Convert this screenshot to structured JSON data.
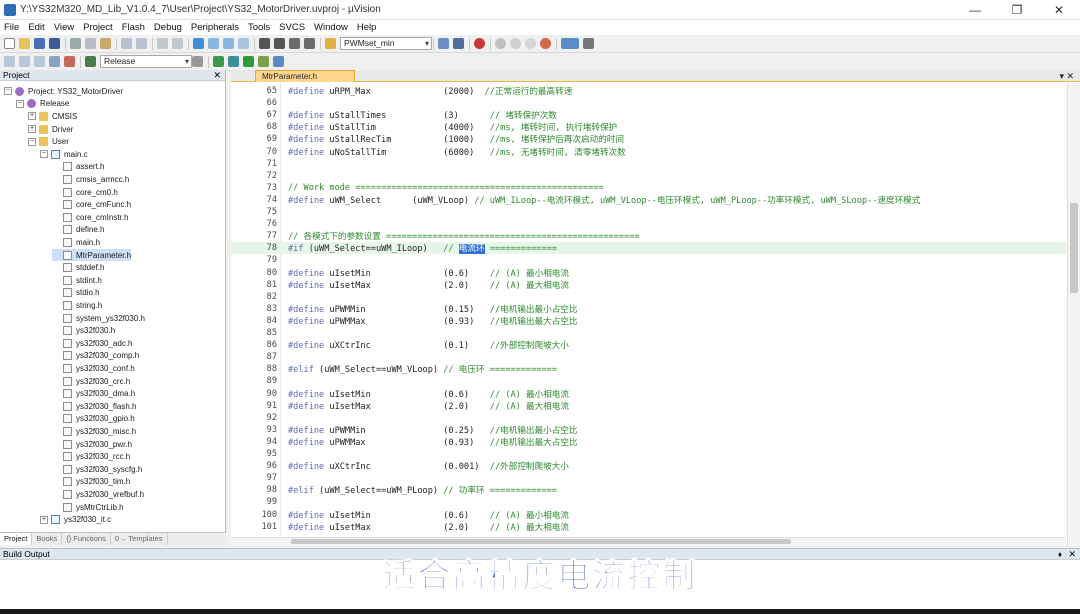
{
  "window": {
    "title": "Y:\\YS32M320_MD_Lib_V1.0.4_7\\User\\Project\\YS32_MotorDriver.uvproj - µVision",
    "controls": [
      "—",
      "❐",
      "✕"
    ]
  },
  "menu": [
    "File",
    "Edit",
    "View",
    "Project",
    "Flash",
    "Debug",
    "Peripherals",
    "Tools",
    "SVCS",
    "Window",
    "Help"
  ],
  "toolbar": {
    "find_combo": "PWMset_min",
    "target_combo": "Release"
  },
  "project_panel": {
    "title": "Project",
    "close": "✕",
    "tree": [
      {
        "label": "Project: YS32_MotorDriver",
        "depth": 0,
        "type": "root",
        "exp": "−"
      },
      {
        "label": "Release",
        "depth": 1,
        "type": "target",
        "exp": "−"
      },
      {
        "label": "CMSIS",
        "depth": 2,
        "type": "folder",
        "exp": "+"
      },
      {
        "label": "Driver",
        "depth": 2,
        "type": "folder",
        "exp": "+"
      },
      {
        "label": "User",
        "depth": 2,
        "type": "folder",
        "exp": "−"
      },
      {
        "label": "main.c",
        "depth": 3,
        "type": "cfile",
        "exp": "−"
      },
      {
        "label": "assert.h",
        "depth": 4,
        "type": "file"
      },
      {
        "label": "cmsis_armcc.h",
        "depth": 4,
        "type": "file"
      },
      {
        "label": "core_cm0.h",
        "depth": 4,
        "type": "file"
      },
      {
        "label": "core_cmFunc.h",
        "depth": 4,
        "type": "file"
      },
      {
        "label": "core_cmInstr.h",
        "depth": 4,
        "type": "file"
      },
      {
        "label": "define.h",
        "depth": 4,
        "type": "file"
      },
      {
        "label": "main.h",
        "depth": 4,
        "type": "file"
      },
      {
        "label": "MtrParameter.h",
        "depth": 4,
        "type": "file",
        "selected": true
      },
      {
        "label": "stddef.h",
        "depth": 4,
        "type": "file"
      },
      {
        "label": "stdint.h",
        "depth": 4,
        "type": "file"
      },
      {
        "label": "stdio.h",
        "depth": 4,
        "type": "file"
      },
      {
        "label": "string.h",
        "depth": 4,
        "type": "file"
      },
      {
        "label": "system_ys32f030.h",
        "depth": 4,
        "type": "file"
      },
      {
        "label": "ys32f030.h",
        "depth": 4,
        "type": "file"
      },
      {
        "label": "ys32f030_adc.h",
        "depth": 4,
        "type": "file"
      },
      {
        "label": "ys32f030_comp.h",
        "depth": 4,
        "type": "file"
      },
      {
        "label": "ys32f030_conf.h",
        "depth": 4,
        "type": "file"
      },
      {
        "label": "ys32f030_crc.h",
        "depth": 4,
        "type": "file"
      },
      {
        "label": "ys32f030_dma.h",
        "depth": 4,
        "type": "file"
      },
      {
        "label": "ys32f030_flash.h",
        "depth": 4,
        "type": "file"
      },
      {
        "label": "ys32f030_gpio.h",
        "depth": 4,
        "type": "file"
      },
      {
        "label": "ys32f030_misc.h",
        "depth": 4,
        "type": "file"
      },
      {
        "label": "ys32f030_pwr.h",
        "depth": 4,
        "type": "file"
      },
      {
        "label": "ys32f030_rcc.h",
        "depth": 4,
        "type": "file"
      },
      {
        "label": "ys32f030_syscfg.h",
        "depth": 4,
        "type": "file"
      },
      {
        "label": "ys32f030_tim.h",
        "depth": 4,
        "type": "file"
      },
      {
        "label": "ys32f030_vrefbuf.h",
        "depth": 4,
        "type": "file"
      },
      {
        "label": "ysMtrCtrLib.h",
        "depth": 4,
        "type": "file"
      },
      {
        "label": "ys32f030_it.c",
        "depth": 3,
        "type": "cfile",
        "exp": "+"
      }
    ],
    "tabs": [
      "Project",
      "Books",
      "{} Functions",
      "0→ Templates"
    ]
  },
  "editor": {
    "tab_label": "MtrParameter.h",
    "tab_controls": "▾ ✕",
    "lines": [
      {
        "n": "65",
        "t": [
          [
            "pp",
            "#define"
          ],
          [
            "nm",
            " uRPM_Max              (2000)  "
          ],
          [
            "cm",
            "//正常运行的最高转速"
          ]
        ]
      },
      {
        "n": "66",
        "t": []
      },
      {
        "n": "67",
        "t": [
          [
            "pp",
            "#define"
          ],
          [
            "nm",
            " uStallTimes           (3)      "
          ],
          [
            "cm",
            "// 堵转保护次数"
          ]
        ]
      },
      {
        "n": "68",
        "t": [
          [
            "pp",
            "#define"
          ],
          [
            "nm",
            " uStallTim             (4000)   "
          ],
          [
            "cm",
            "//ms, 堵转时间, 执行堵转保护"
          ]
        ]
      },
      {
        "n": "69",
        "t": [
          [
            "pp",
            "#define"
          ],
          [
            "nm",
            " uStallRecTim          (1000)   "
          ],
          [
            "cm",
            "//ms, 堵转保护后再次启动的时间"
          ]
        ]
      },
      {
        "n": "70",
        "t": [
          [
            "pp",
            "#define"
          ],
          [
            "nm",
            " uNoStallTim           (6000)   "
          ],
          [
            "cm",
            "//ms, 无堵转时间, 清零堵转次数"
          ]
        ]
      },
      {
        "n": "71",
        "t": []
      },
      {
        "n": "72",
        "t": []
      },
      {
        "n": "73",
        "t": [
          [
            "cm",
            "// Work mode ================================================"
          ]
        ]
      },
      {
        "n": "74",
        "t": [
          [
            "pp",
            "#define"
          ],
          [
            "nm",
            " uWM_Select      (uWM_VLoop) "
          ],
          [
            "cm",
            "// uWM_ILoop--电流环模式, uWM_VLoop--电压环模式, uWM_PLoop--功率环模式, uWM_SLoop--速度环模式"
          ]
        ]
      },
      {
        "n": "75",
        "t": []
      },
      {
        "n": "76",
        "t": []
      },
      {
        "n": "77",
        "t": [
          [
            "cm",
            "// 各模式下的参数设置 ================================================="
          ]
        ]
      },
      {
        "n": "78",
        "t": [
          [
            "pp",
            "#if"
          ],
          [
            "nm",
            " (uWM_Select==uWM_ILoop)   "
          ],
          [
            "cm",
            "// "
          ],
          [
            "sel",
            "电流环"
          ],
          [
            "cm",
            " ============="
          ]
        ],
        "hl": true
      },
      {
        "n": "79",
        "t": []
      },
      {
        "n": "80",
        "t": [
          [
            "pp",
            "#define"
          ],
          [
            "nm",
            " uIsetMin              (0.6)    "
          ],
          [
            "cm",
            "// (A) 最小相电流"
          ]
        ]
      },
      {
        "n": "81",
        "t": [
          [
            "pp",
            "#define"
          ],
          [
            "nm",
            " uIsetMax              (2.0)    "
          ],
          [
            "cm",
            "// (A) 最大相电流"
          ]
        ]
      },
      {
        "n": "82",
        "t": []
      },
      {
        "n": "83",
        "t": [
          [
            "pp",
            "#define"
          ],
          [
            "nm",
            " uPWMMin               (0.15)   "
          ],
          [
            "cm",
            "//电机输出最小占空比"
          ]
        ]
      },
      {
        "n": "84",
        "t": [
          [
            "pp",
            "#define"
          ],
          [
            "nm",
            " uPWMMax               (0.93)   "
          ],
          [
            "cm",
            "//电机输出最大占空比"
          ]
        ]
      },
      {
        "n": "85",
        "t": []
      },
      {
        "n": "86",
        "t": [
          [
            "pp",
            "#define"
          ],
          [
            "nm",
            " uXCtrInc              (0.1)    "
          ],
          [
            "cm",
            "//外部控制爬坡大小"
          ]
        ]
      },
      {
        "n": "87",
        "t": []
      },
      {
        "n": "88",
        "t": [
          [
            "pp",
            "#elif"
          ],
          [
            "nm",
            " (uWM_Select==uWM_VLoop) "
          ],
          [
            "cm",
            "// 电压环 ============="
          ]
        ]
      },
      {
        "n": "89",
        "t": []
      },
      {
        "n": "90",
        "t": [
          [
            "pp",
            "#define"
          ],
          [
            "nm",
            " uIsetMin              (0.6)    "
          ],
          [
            "cm",
            "// (A) 最小相电流"
          ]
        ]
      },
      {
        "n": "91",
        "t": [
          [
            "pp",
            "#define"
          ],
          [
            "nm",
            " uIsetMax              (2.0)    "
          ],
          [
            "cm",
            "// (A) 最大相电流"
          ]
        ]
      },
      {
        "n": "92",
        "t": []
      },
      {
        "n": "93",
        "t": [
          [
            "pp",
            "#define"
          ],
          [
            "nm",
            " uPWMMin               (0.25)   "
          ],
          [
            "cm",
            "//电机输出最小占空比"
          ]
        ]
      },
      {
        "n": "94",
        "t": [
          [
            "pp",
            "#define"
          ],
          [
            "nm",
            " uPWMMax               (0.93)   "
          ],
          [
            "cm",
            "//电机输出最大占空比"
          ]
        ]
      },
      {
        "n": "95",
        "t": []
      },
      {
        "n": "96",
        "t": [
          [
            "pp",
            "#define"
          ],
          [
            "nm",
            " uXCtrInc              (0.001)  "
          ],
          [
            "cm",
            "//外部控制爬坡大小"
          ]
        ]
      },
      {
        "n": "97",
        "t": []
      },
      {
        "n": "98",
        "t": [
          [
            "pp",
            "#elif"
          ],
          [
            "nm",
            " (uWM_Select==uWM_PLoop) "
          ],
          [
            "cm",
            "// 功率环 ============="
          ]
        ]
      },
      {
        "n": "99",
        "t": []
      },
      {
        "n": "100",
        "t": [
          [
            "pp",
            "#define"
          ],
          [
            "nm",
            " uIsetMin              (0.6)    "
          ],
          [
            "cm",
            "// (A) 最小相电流"
          ]
        ]
      },
      {
        "n": "101",
        "t": [
          [
            "pp",
            "#define"
          ],
          [
            "nm",
            " uIsetMax              (2.0)    "
          ],
          [
            "cm",
            "// (A) 最大相电流"
          ]
        ]
      }
    ]
  },
  "build_output": {
    "title": "Build Output",
    "pin": "♦",
    "close": "✕"
  },
  "caption": "适合高精度电流控制",
  "colors": {
    "caption": "#2a44c4",
    "tab_active": "#ffd690",
    "preprocessor": "#5f6bb8",
    "comment": "#2e8b2e",
    "highlight_line": "#e7f6e9"
  }
}
